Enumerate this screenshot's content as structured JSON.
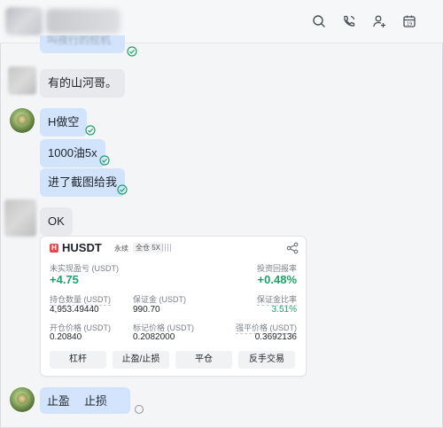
{
  "header": {
    "icons": [
      "search-icon",
      "phone-icon",
      "add-member-icon",
      "calendar-icon"
    ]
  },
  "messages": {
    "top_partial": "叫夜行的挖机",
    "m1": "有的山河哥。",
    "m2": "H做空",
    "m3": "1000油5x",
    "m4": "进了截图给我",
    "m5": "OK",
    "m6_part1": "止盈",
    "m6_part2": "止损"
  },
  "card": {
    "symbol": "HUSDT",
    "tag_perpetual": "永续",
    "tag_margin": "全仓 5X",
    "unrealized_pnl_label": "未实现盈亏 (USDT)",
    "unrealized_pnl_value": "+4.75",
    "roi_label": "投资回报率",
    "roi_value": "+0.48%",
    "position_size_label": "持仓数量 (USDT)",
    "position_size_value": "4,953.49440",
    "margin_label": "保证金 (USDT)",
    "margin_value": "990.70",
    "margin_ratio_label": "保证金比率",
    "margin_ratio_value": "3.51%",
    "entry_price_label": "开仓价格 (USDT)",
    "entry_price_value": "0.20840",
    "mark_price_label": "标记价格 (USDT)",
    "mark_price_value": "0.2082000",
    "liq_price_label": "强平价格 (USDT)",
    "liq_price_value": "0.3692136",
    "buttons": [
      "杠杆",
      "止盈/止损",
      "平仓",
      "反手交易"
    ]
  },
  "colors": {
    "accent_green": "#1fa36b",
    "bubble_blue": "#d2e4fc",
    "bubble_gray": "#e7e9ec"
  }
}
